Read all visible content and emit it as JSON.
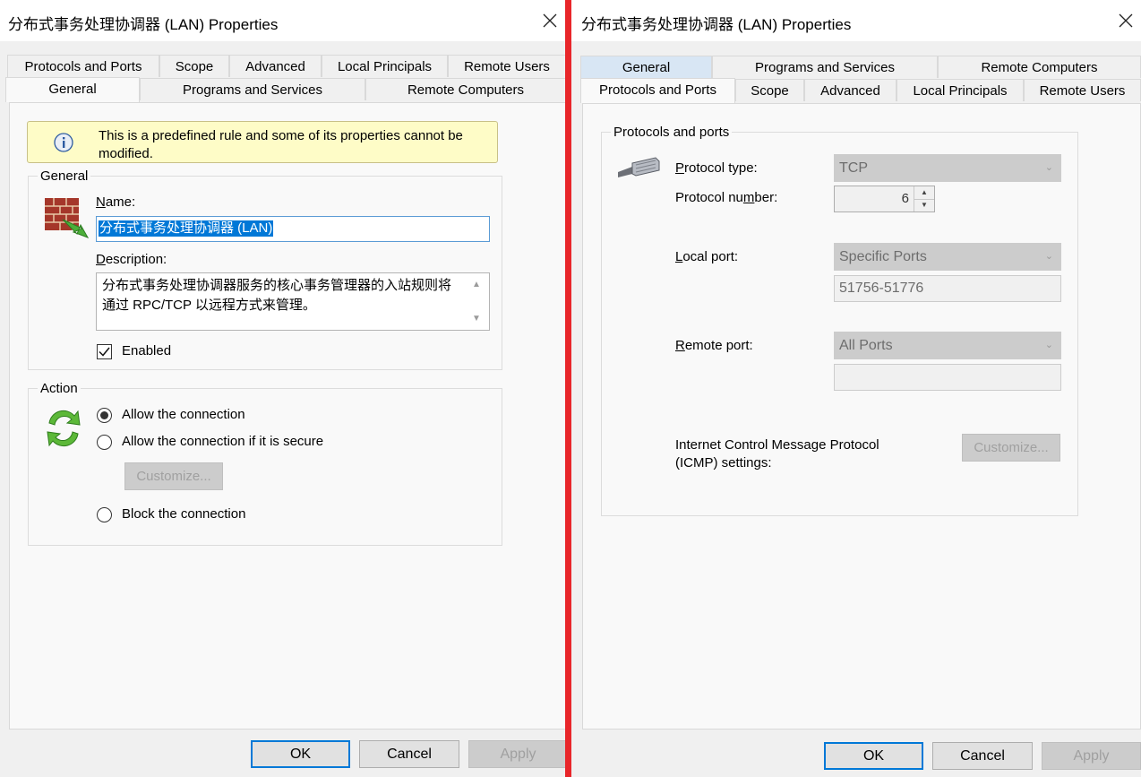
{
  "left": {
    "title": "分布式事务处理协调器 (LAN) Properties",
    "tabs_row1": [
      "Protocols and Ports",
      "Scope",
      "Advanced",
      "Local Principals",
      "Remote Users"
    ],
    "tabs_row2": [
      "General",
      "Programs and Services",
      "Remote Computers"
    ],
    "selected_tab": "General",
    "info_text": "This is a predefined rule and some of its properties cannot be modified.",
    "general_group_label": "General",
    "name_label": "Name:",
    "name_value": "分布式事务处理协调器 (LAN)",
    "description_label": "Description:",
    "description_value": "分布式事务处理协调器服务的核心事务管理器的入站规则将通过 RPC/TCP 以远程方式来管理。",
    "enabled_label": "Enabled",
    "enabled_checked": true,
    "action_group_label": "Action",
    "action_options": [
      "Allow the connection",
      "Allow the connection if it is secure",
      "Block the connection"
    ],
    "selected_action": 0,
    "customize_label": "Customize...",
    "ok_label": "OK",
    "cancel_label": "Cancel",
    "apply_label": "Apply"
  },
  "right": {
    "title": "分布式事务处理协调器 (LAN) Properties",
    "tabs_row1": [
      "General",
      "Programs and Services",
      "Remote Computers"
    ],
    "tabs_row2": [
      "Protocols and Ports",
      "Scope",
      "Advanced",
      "Local Principals",
      "Remote Users"
    ],
    "selected_tab": "Protocols and Ports",
    "group_label": "Protocols and ports",
    "protocol_type_label": "Protocol type:",
    "protocol_type_value": "TCP",
    "protocol_number_label": "Protocol number:",
    "protocol_number_value": "6",
    "local_port_label": "Local port:",
    "local_port_mode": "Specific Ports",
    "local_port_value": "51756-51776",
    "remote_port_label": "Remote port:",
    "remote_port_mode": "All Ports",
    "remote_port_value": "",
    "icmp_label_line1": "Internet Control Message Protocol",
    "icmp_label_line2": "(ICMP) settings:",
    "customize_label": "Customize...",
    "ok_label": "OK",
    "cancel_label": "Cancel",
    "apply_label": "Apply"
  },
  "colors": {
    "divider": "#e8262a",
    "selection": "#0078d7",
    "info_background": "#fefcc7",
    "tab_highlight": "#d8e6f4"
  },
  "icons": [
    "close-icon",
    "info-icon",
    "firewall-icon",
    "action-arrows-icon",
    "network-cable-icon",
    "checkmark-icon"
  ]
}
